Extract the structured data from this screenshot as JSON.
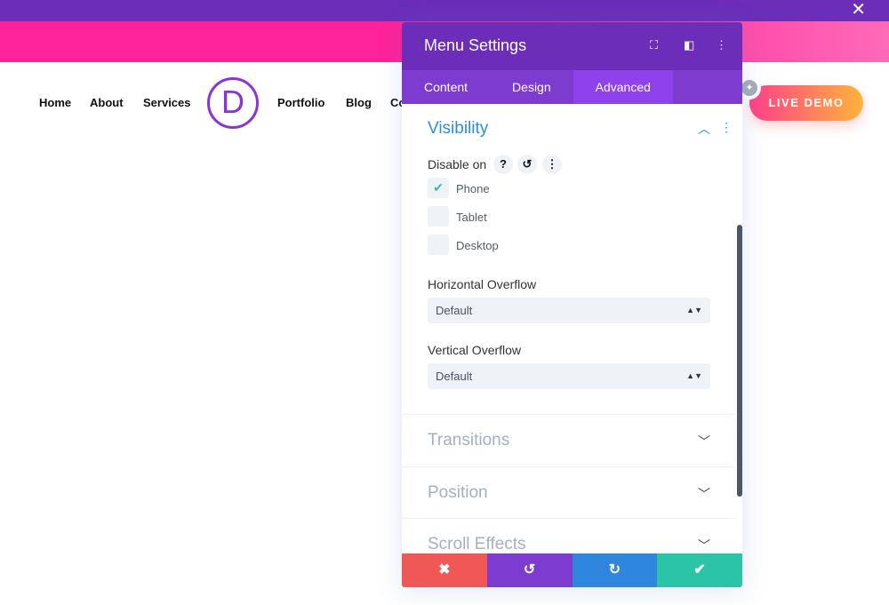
{
  "topbar": {
    "close": "✕"
  },
  "nav": {
    "items": [
      "Home",
      "About",
      "Services",
      "Portfolio",
      "Blog",
      "Co"
    ],
    "logo": "D",
    "live_demo": "LIVE DEMO"
  },
  "panel": {
    "title": "Menu Settings",
    "tabs": [
      "Content",
      "Design",
      "Advanced"
    ],
    "active_tab": "Advanced",
    "visibility": {
      "title": "Visibility",
      "disable_on": "Disable on",
      "options": [
        {
          "label": "Phone",
          "checked": true
        },
        {
          "label": "Tablet",
          "checked": false
        },
        {
          "label": "Desktop",
          "checked": false
        }
      ]
    },
    "horizontal_overflow": {
      "label": "Horizontal Overflow",
      "value": "Default"
    },
    "vertical_overflow": {
      "label": "Vertical Overflow",
      "value": "Default"
    },
    "sections": [
      "Transitions",
      "Position",
      "Scroll Effects"
    ]
  },
  "colors": {
    "purple": "#6c2eb9",
    "accent": "#2e8de0",
    "cancel": "#f05757",
    "undo": "#7e3bd0",
    "redo": "#2e87dc",
    "save": "#2bc4a8"
  }
}
